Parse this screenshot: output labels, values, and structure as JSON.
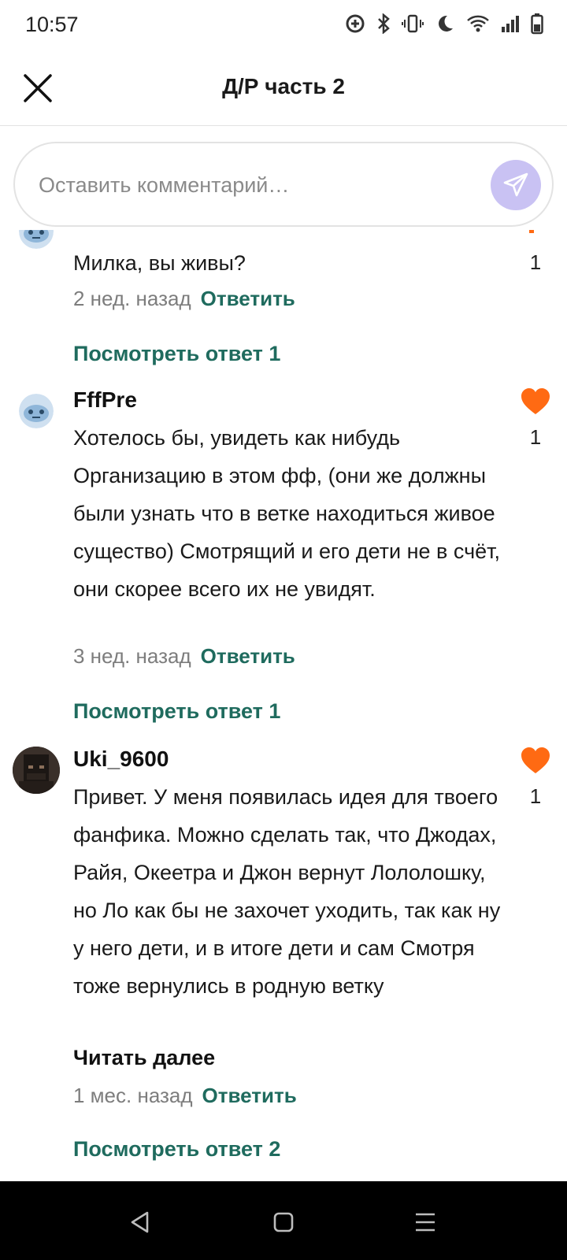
{
  "status_bar": {
    "time": "10:57",
    "icons": [
      "data-saver-icon",
      "bluetooth-icon",
      "vibrate-icon",
      "do-not-disturb-icon",
      "wifi-icon",
      "signal-icon",
      "battery-icon"
    ]
  },
  "header": {
    "title": "Д/Р часть 2",
    "close_icon": "close-icon"
  },
  "comment_input": {
    "placeholder": "Оставить комментарий…",
    "send_icon": "send-icon"
  },
  "comments": [
    {
      "username": "",
      "text": "Милка, вы живы?",
      "time": "2 нед. назад",
      "reply_label": "Ответить",
      "likes": "1",
      "view_replies": "Посмотреть ответ 1"
    },
    {
      "username": "FffPre",
      "text": "Хотелось бы, увидеть как нибудь Организацию в этом фф, (они же должны были узнать что в ветке находиться живое существо) Смотрящий и его дети не в счёт, они скорее всего их не увидят.",
      "time": "3 нед. назад",
      "reply_label": "Ответить",
      "likes": "1",
      "view_replies": "Посмотреть ответ 1"
    },
    {
      "username": "Uki_9600",
      "text": "Привет. У меня появилась идея для твоего фанфика. Можно сделать так, что Джодах, Райя, Океетра и Джон вернут Лололошку, но Ло как бы не захочет уходить, так как ну у него дети, и в итоге дети и сам Смотря тоже вернулись в родную ветку",
      "read_more": "Читать далее",
      "time": "1 мес. назад",
      "reply_label": "Ответить",
      "likes": "1",
      "view_replies": "Посмотреть ответ 2"
    }
  ],
  "colors": {
    "accent": "#1f6b5e",
    "like": "#ff6a13",
    "send_button": "#c9c2f3"
  },
  "nav_bar": {
    "icons": [
      "back-icon",
      "home-icon",
      "recents-icon"
    ]
  }
}
